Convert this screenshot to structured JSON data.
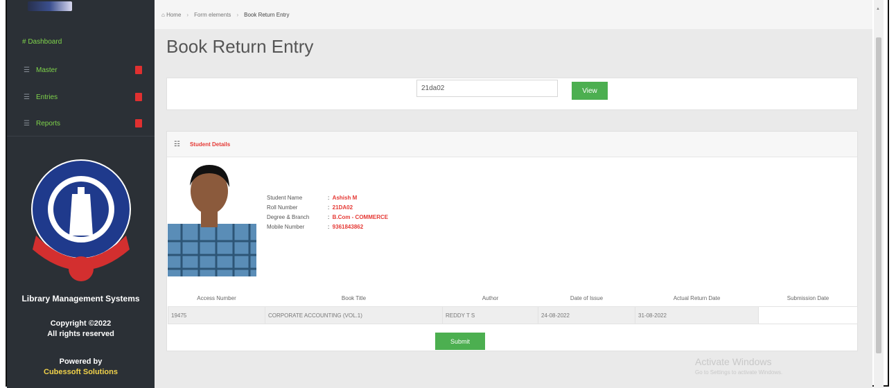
{
  "sidebar": {
    "dashboard_label": "# Dashboard",
    "items": [
      {
        "label": "Master"
      },
      {
        "label": "Entries"
      },
      {
        "label": "Reports"
      }
    ],
    "app_title": "Library Management Systems",
    "copyright_line1": "Copyright ©2022",
    "copyright_line2": "All rights reserved",
    "powered_by": "Powered by",
    "company": "Cubessoft Solutions"
  },
  "breadcrumb": {
    "home": "Home",
    "section": "Form elements",
    "current": "Book Return Entry"
  },
  "page": {
    "title": "Book Return Entry"
  },
  "search": {
    "value": "21da02",
    "view_label": "View"
  },
  "student": {
    "panel_title": "Student Details",
    "fields": [
      {
        "label": "Student Name",
        "value": "Ashish M"
      },
      {
        "label": "Roll Number",
        "value": "21DA02"
      },
      {
        "label": "Degree & Branch",
        "value": "B.Com - COMMERCE"
      },
      {
        "label": "Mobile Number",
        "value": "9361843862"
      }
    ]
  },
  "books": {
    "columns": [
      "Access Number",
      "Book Title",
      "Author",
      "Date of Issue",
      "Actual Return Date",
      "Submission Date"
    ],
    "rows": [
      [
        "19475",
        "CORPORATE ACCOUNTING (VOL.1)",
        "REDDY T S",
        "24-08-2022",
        "31-08-2022",
        ""
      ]
    ]
  },
  "submit_label": "Submit",
  "watermark": {
    "line1": "Activate Windows",
    "line2": "Go to Settings to activate Windows."
  },
  "colors": {
    "sidebar_bg": "#2b3036",
    "accent_green": "#4caf50",
    "accent_red": "#e53935",
    "menu_text": "#7fd44b"
  }
}
